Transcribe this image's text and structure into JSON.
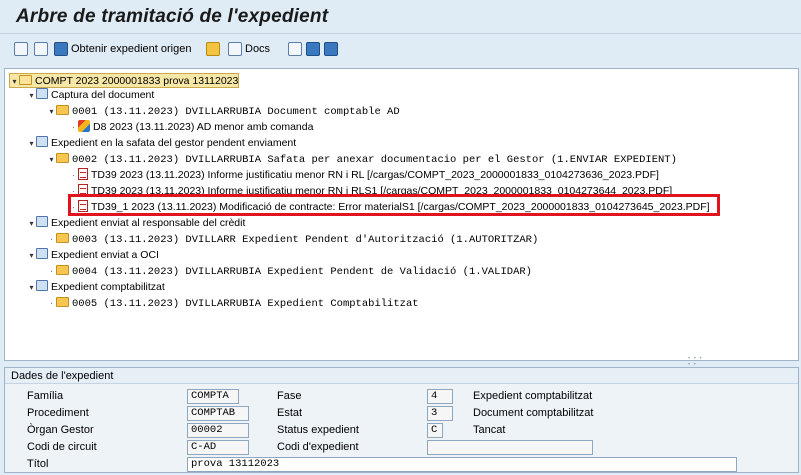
{
  "title": "Arbre de tramitació de l'expedient",
  "toolbar": {
    "obtenir_label": "Obtenir expedient origen",
    "docs_label": "Docs"
  },
  "tree": {
    "root": "COMPT 2023 2000001833 prova 13112023",
    "group1": "Captura del document",
    "g1_folder": "0001 (13.11.2023) DVILLARRUBIA Document comptable AD",
    "g1_item": "D8 2023 (13.11.2023) AD menor amb comanda",
    "group2": "Expedient en la safata del gestor pendent enviament",
    "g2_folder": "0002 (13.11.2023) DVILLARRUBIA Safata per anexar documentacio per el Gestor (1.ENVIAR EXPEDIENT)",
    "g2_item1": "TD39 2023 (13.11.2023) Informe justificatiu menor RN i RL [/cargas/COMPT_2023_2000001833_0104273636_2023.PDF]",
    "g2_item2": "TD39 2023 (13.11.2023) Informe justificatiu menor RN i RLS1 [/cargas/COMPT_2023_2000001833_0104273644_2023.PDF]",
    "g2_item3": "TD39_1 2023 (13.11.2023) Modificació de contracte: Error materialS1 [/cargas/COMPT_2023_2000001833_0104273645_2023.PDF]",
    "group3": "Expedient enviat al responsable del crèdit",
    "g3_folder": "0003 (13.11.2023) DVILLARR Expedient Pendent d'Autorització (1.AUTORITZAR)",
    "group4": "Expedient enviat a OCI",
    "g4_folder": "0004 (13.11.2023) DVILLARRUBIA Expedient Pendent de Validació (1.VALIDAR)",
    "group5": "Expedient comptabilitzat",
    "g5_folder": "0005 (13.11.2023) DVILLARRUBIA Expedient Comptabilitzat"
  },
  "details": {
    "header": "Dades de l'expedient",
    "familia_label": "Família",
    "familia_value": "COMPTA",
    "procediment_label": "Procediment",
    "procediment_value": "COMPTAB",
    "organ_label": "Òrgan Gestor",
    "organ_value": "00002",
    "circuit_label": "Codi de circuit",
    "circuit_value": "C-AD",
    "titol_label": "Títol",
    "titol_value": "prova 13112023",
    "fase_label": "Fase",
    "fase_value": "4",
    "fase_text": "Expedient comptabilitzat",
    "estat_label": "Estat",
    "estat_value": "3",
    "estat_text": "Document comptabilitzat",
    "status_label": "Status expedient",
    "status_value": "C",
    "status_text": "Tancat",
    "codi_exp_label": "Codi d'expedient",
    "codi_exp_value": ""
  }
}
